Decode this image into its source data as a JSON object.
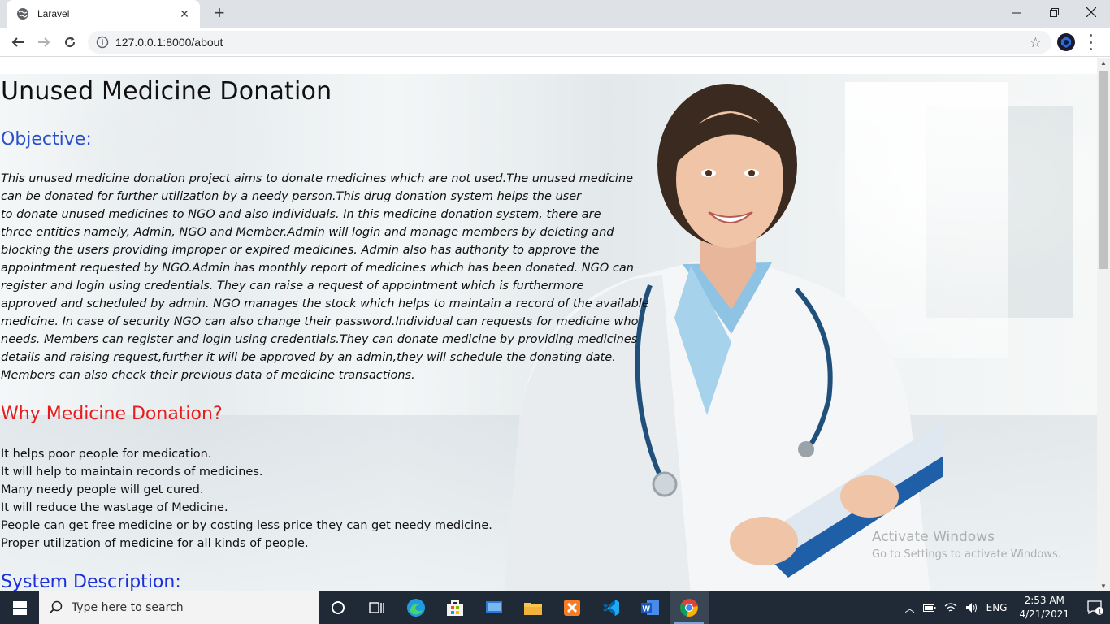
{
  "browser": {
    "tab_title": "Laravel",
    "new_tab": "+",
    "url": "127.0.0.1:8000/about"
  },
  "page": {
    "title": "Unused Medicine Donation",
    "objective_heading": "Objective:",
    "objective_lines": [
      "This unused medicine donation project aims to donate medicines which are not used.The unused medicine",
      "can be donated for further utilization by a needy person.This drug donation system helps the user",
      "to donate unused medicines to NGO and also individuals. In this medicine donation system, there are",
      "three entities namely, Admin, NGO and Member.Admin will login and manage members by deleting and",
      "blocking the users providing improper or expired medicines. Admin also has authority to approve the",
      "appointment requested by NGO.Admin has monthly report of medicines which has been donated. NGO can",
      "register and login using credentials. They can raise a request of appointment which is furthermore",
      "approved and scheduled by admin. NGO manages the stock which helps to maintain a record of the available",
      "medicine. In case of security NGO can also change their password.Individual can requests for medicine who",
      "needs. Members can register and login using credentials.They can donate medicine by providing medicines",
      "details and raising request,further it will be approved by an admin,they will schedule the donating date.",
      "Members can also check their previous data of medicine transactions."
    ],
    "why_heading": "Why Medicine Donation?",
    "why_items": [
      "It helps poor people for medication.",
      "It will help to maintain records of medicines.",
      "Many needy people will get cured.",
      "It will reduce the wastage of Medicine.",
      "People can get free medicine or by costing less price they can get needy medicine.",
      "Proper utilization of medicine for all kinds of people."
    ],
    "system_heading": "System Description:"
  },
  "watermark": {
    "line1": "Activate Windows",
    "line2": "Go to Settings to activate Windows."
  },
  "taskbar": {
    "search_placeholder": "Type here to search",
    "language": "ENG",
    "time": "2:53 AM",
    "date": "4/21/2021",
    "notification_count": "1"
  },
  "colors": {
    "objective_heading": "#2b4fc9",
    "why_heading": "#e81c1c",
    "system_heading": "#1c2fd8"
  }
}
